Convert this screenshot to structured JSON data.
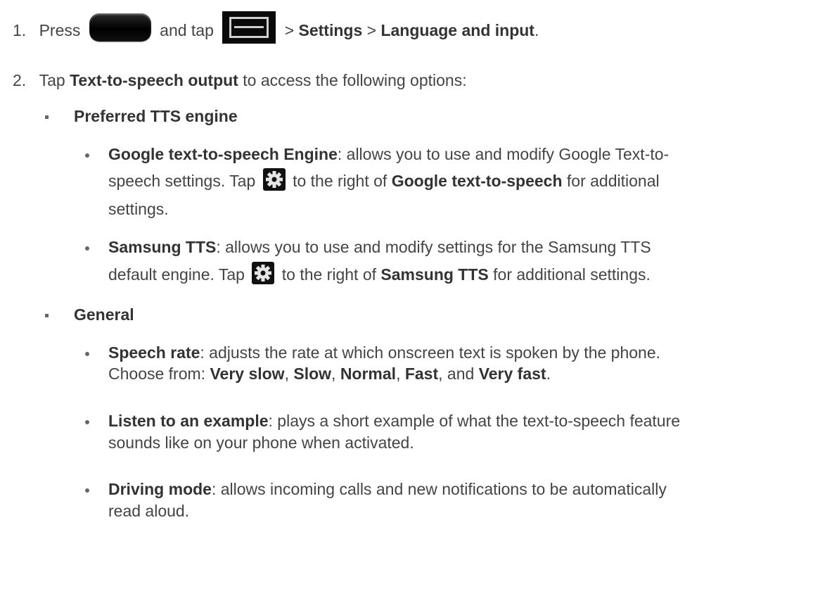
{
  "steps": [
    {
      "number": "1.",
      "press_text": "Press",
      "and_tap_text": "and tap",
      "sep1": ">",
      "settings": "Settings",
      "sep2": ">",
      "language_and_input": "Language and input",
      "end": ".",
      "icons": [
        "home-key-icon",
        "menu-key-icon"
      ]
    },
    {
      "number": "2.",
      "tap_text": "Tap",
      "tts_output": "Text-to-speech output",
      "rest": "to access the following options:"
    }
  ],
  "sections": [
    {
      "heading": "Preferred TTS engine",
      "items": [
        {
          "term": "Google text-to-speech Engine",
          "line1": ": allows you to use and modify Google Text-to-",
          "line2_pre": "speech settings. Tap",
          "line2_post": "to the right of",
          "line2_bold": "Google text-to-speech",
          "line2_end": "for additional",
          "line3": "settings."
        },
        {
          "term": "Samsung TTS",
          "line1": ": allows you to use and modify settings for the Samsung TTS",
          "line2_pre": "default engine. Tap",
          "line2_post": "to the right of",
          "line2_bold": "Samsung TTS",
          "line2_end": "for additional settings."
        }
      ]
    },
    {
      "heading": "General",
      "items": [
        {
          "term": "Speech rate",
          "line1": ": adjusts the rate at which onscreen text is spoken by the phone.",
          "choose": "Choose from:",
          "opt1": "Very slow",
          "comma1": ",",
          "opt2": "Slow",
          "comma2": ",",
          "opt3": "Normal",
          "comma3": ",",
          "opt4": "Fast",
          "and": ", and",
          "opt5": "Very fast",
          "period": "."
        },
        {
          "term": "Listen to an example",
          "line1": ": plays a short example of what the text-to-speech feature",
          "line2": "sounds like on your phone when activated."
        },
        {
          "term": "Driving mode",
          "line1": ": allows incoming calls and new notifications to be automatically",
          "line2": "read aloud."
        }
      ]
    }
  ]
}
